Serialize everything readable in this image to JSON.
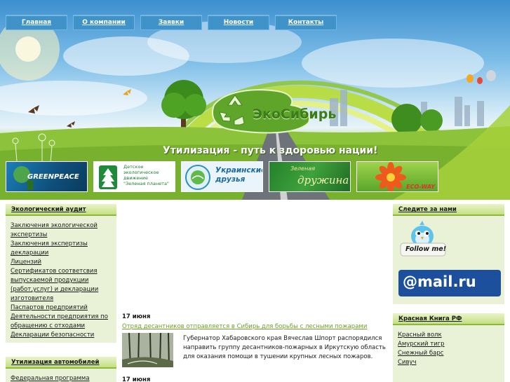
{
  "nav": [
    "Главная",
    "О компании",
    "Заявки",
    "Новости",
    "Контакты"
  ],
  "header": {
    "logo_text": "ЭкоСибирь",
    "slogan": "Утилизация - путь к здоровью нации!"
  },
  "partners": [
    {
      "name": "GREENPEACE"
    },
    {
      "name": "Детское экологическое движение \"Зеленая планета\"",
      "lines": [
        "Детское",
        "экологическое",
        "движение",
        "\"Зеленая планета\""
      ]
    },
    {
      "name": "Украинские друзья",
      "lines": [
        "Украинские",
        "друзья"
      ]
    },
    {
      "name": "Зеленая дружина",
      "lines": [
        "Зеленая",
        "дружина"
      ]
    },
    {
      "name": "ECO-WAY"
    }
  ],
  "left": {
    "audit": {
      "title": "Экологический аудит",
      "links": [
        "Заключения экологической экспертизы",
        "Заключения экспертизы декларации",
        "Лицензий",
        "Сертификатов соответсвия выпускаемой продукции (работ,услуг) и декларации изготовителя",
        "Паспартов предприятий",
        "Деятельности предприятия по обращению с отходами",
        "Декларации безопасности"
      ]
    },
    "auto": {
      "title": "Утилизация автомобилей",
      "links": [
        "Федеральная программа"
      ]
    }
  },
  "news": [
    {
      "date": "17 июня",
      "title": "Отряд десантников отправляется в Сибирь для борьбы с лесными пожарами",
      "text": "Губернатор Хабаровского края Вячеслав Шпорт распорядился направить группу десантников-пожарных в Иркутскую область для оказания помощи в тушении крупных лесных пожаров."
    },
    {
      "date": "17 июня"
    }
  ],
  "right": {
    "follow": {
      "title": "Следите за нами",
      "twitter": "Follow me!",
      "mail": "@mail.ru"
    },
    "redbook": {
      "title": "Красная Книга РФ",
      "links": [
        "Красный волк",
        "Амурский тигр",
        "Снежный барс",
        "Сивуч"
      ]
    }
  },
  "colors": {
    "nav_bg": "#3f93c9",
    "box_bg": "#e9f1d6",
    "box_head_border": "#8eb83a",
    "link_green": "#6ba126",
    "mail_blue": "#1c4f9c",
    "mail_orange": "#f7941d"
  }
}
